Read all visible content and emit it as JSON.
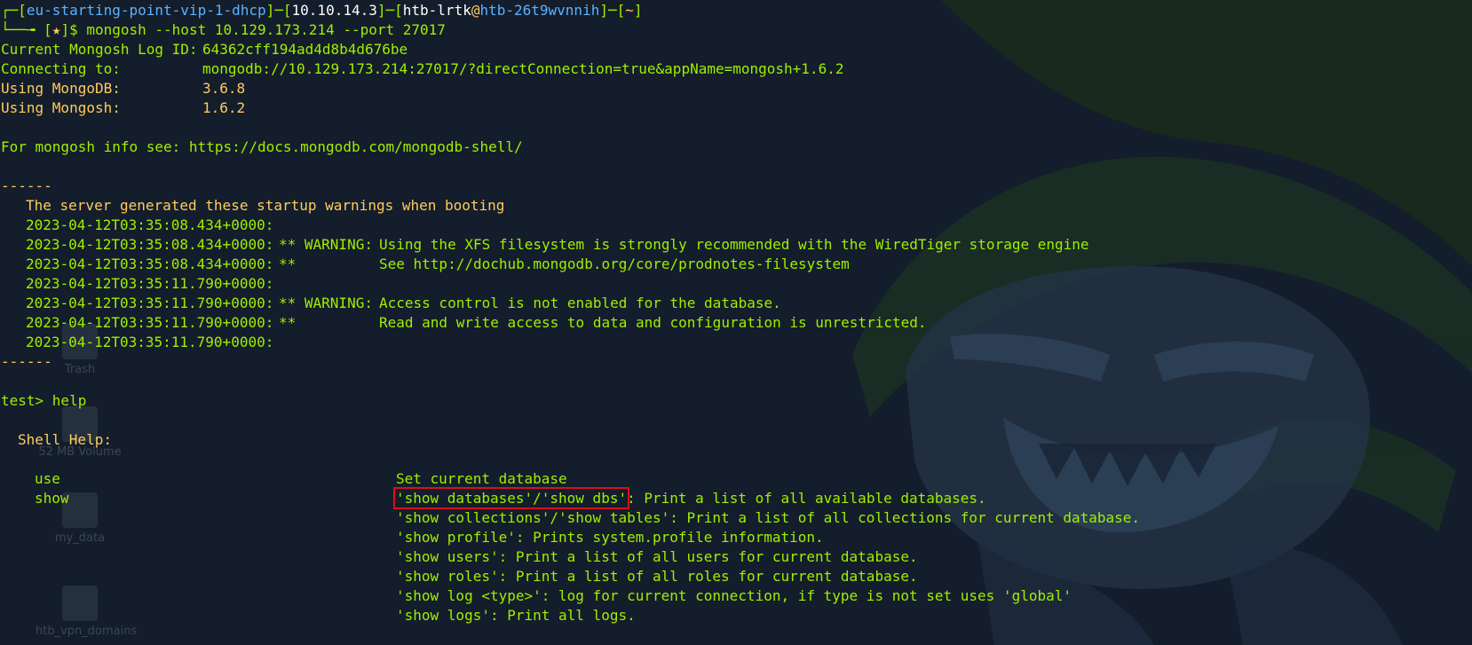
{
  "desktop_icons": [
    {
      "label": "Trash",
      "icon": "trash-icon"
    },
    {
      "label": "52 MB Volume",
      "icon": "volume-icon"
    },
    {
      "label": "my_data",
      "icon": "folder-icon"
    },
    {
      "label": "htb_vpn_domains",
      "icon": "file-icon"
    }
  ],
  "prompt": {
    "corner_top": "┌─[",
    "vpn": "eu-starting-point-vip-1-dhcp",
    "sep1": "]─[",
    "ip": "10.10.14.3",
    "sep2": "]─[",
    "user": "htb-lrtk",
    "at": "@",
    "host": "htb-26t9wvnnih",
    "sep3": "]─[",
    "dir": "~",
    "close": "]",
    "corner_bottom": "└──╼ [",
    "star": "★",
    "dollar": "]$ ",
    "command": "mongosh --host 10.129.173.214 --port 27017"
  },
  "output": {
    "log_id_label": "Current Mongosh Log ID:",
    "log_id": "64362cff194ad4d8b4d676be",
    "connecting_label": "Connecting to:",
    "connecting": "mongodb://10.129.173.214:27017/?directConnection=true&appName=mongosh+1.6.2",
    "mongodb_label": "Using MongoDB:",
    "mongodb": "3.6.8",
    "mongosh_label": "Using Mongosh:",
    "mongosh": "1.6.2",
    "info": "For mongosh info see: https://docs.mongodb.com/mongodb-shell/",
    "dashes": "------",
    "startup": "The server generated these startup warnings when booting",
    "warnings": [
      {
        "ts": "2023-04-12T03:35:08.434+0000:",
        "mark": "",
        "msg": ""
      },
      {
        "ts": "2023-04-12T03:35:08.434+0000:",
        "mark": "** WARNING:",
        "msg": "Using the XFS filesystem is strongly recommended with the WiredTiger storage engine"
      },
      {
        "ts": "2023-04-12T03:35:08.434+0000:",
        "mark": "**",
        "msg": "See http://dochub.mongodb.org/core/prodnotes-filesystem"
      },
      {
        "ts": "2023-04-12T03:35:11.790+0000:",
        "mark": "",
        "msg": ""
      },
      {
        "ts": "2023-04-12T03:35:11.790+0000:",
        "mark": "** WARNING:",
        "msg": "Access control is not enabled for the database."
      },
      {
        "ts": "2023-04-12T03:35:11.790+0000:",
        "mark": "**",
        "msg": "Read and write access to data and configuration is unrestricted."
      },
      {
        "ts": "2023-04-12T03:35:11.790+0000:",
        "mark": "",
        "msg": ""
      }
    ],
    "shell_prompt": "test> ",
    "shell_cmd": "help",
    "shell_help": "Shell Help:",
    "use_cmd": "use",
    "use_desc": "Set current database",
    "show_cmd": "show",
    "show_first_highlight": "'show databases'/'show dbs'",
    "show_first_rest": ": Print a list of all available databases.",
    "show_lines": [
      "'show collections'/'show tables': Print a list of all collections for current database.",
      "'show profile': Prints system.profile information.",
      "'show users': Print a list of all users for current database.",
      "'show roles': Print a list of all roles for current database.",
      "'show log <type>': log for current connection, if type is not set uses 'global'",
      "'show logs': Print all logs."
    ]
  }
}
